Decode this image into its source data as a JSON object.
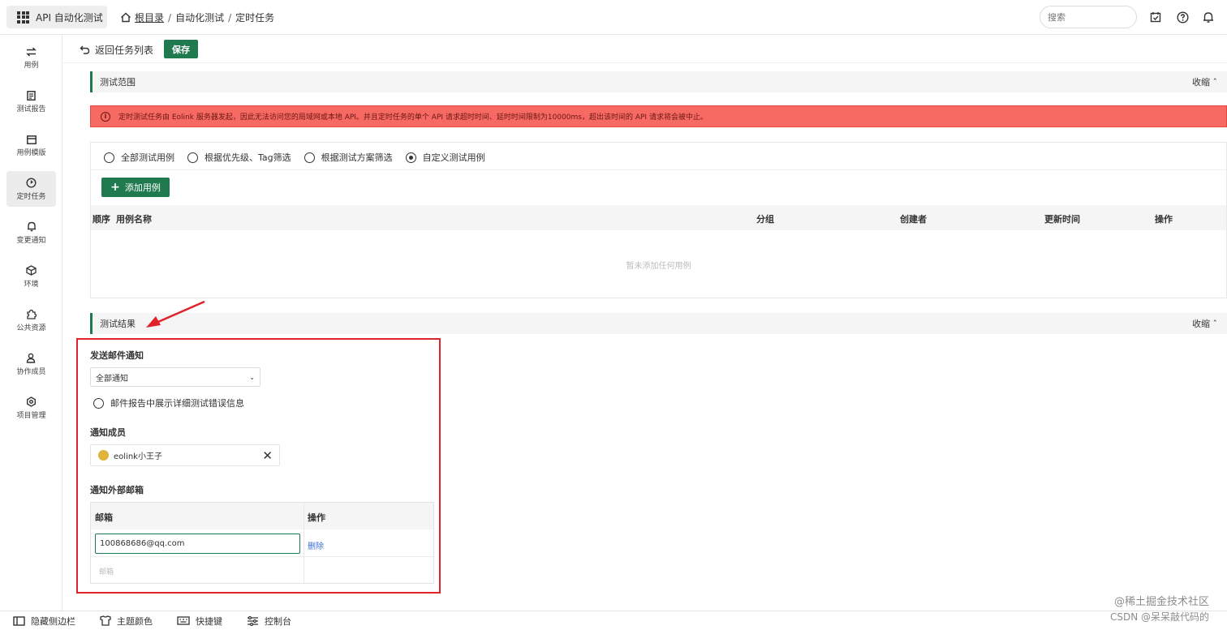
{
  "topbar": {
    "app_label": "API 自动化测试",
    "breadcrumb": {
      "root": "根目录",
      "items": [
        "自动化测试",
        "定时任务"
      ],
      "separator": "/"
    },
    "search_placeholder": "搜索"
  },
  "sidebar": {
    "items": [
      {
        "label": "用例",
        "icon": "swap-icon"
      },
      {
        "label": "测试报告",
        "icon": "report-icon"
      },
      {
        "label": "用例模版",
        "icon": "template-icon"
      },
      {
        "label": "定时任务",
        "icon": "clock-icon",
        "active": true
      },
      {
        "label": "变更通知",
        "icon": "bell-icon"
      },
      {
        "label": "环境",
        "icon": "cube-icon"
      },
      {
        "label": "公共资源",
        "icon": "puzzle-icon"
      },
      {
        "label": "协作成员",
        "icon": "users-icon"
      },
      {
        "label": "项目管理",
        "icon": "gear-icon"
      }
    ]
  },
  "toolbar": {
    "back_label": "返回任务列表",
    "save_label": "保存"
  },
  "scope_section": {
    "title": "测试范围",
    "collapse_label": "收缩",
    "alert": "定时测试任务由 Eolink 服务器发起，因此无法访问您的局域网或本地 API。并且定时任务的单个 API 请求超时时间、延时时间限制为10000ms，超出该时间的 API 请求将会被中止。",
    "radio_options": [
      "全部测试用例",
      "根据优先级、Tag筛选",
      "根据测试方案筛选",
      "自定义测试用例"
    ],
    "selected_option": 3,
    "add_button": "添加用例",
    "table_headers": {
      "order": "顺序",
      "name": "用例名称",
      "group": "分组",
      "creator": "创建者",
      "updated": "更新时间",
      "actions": "操作"
    },
    "empty_text": "暂未添加任何用例"
  },
  "result_section": {
    "title": "测试结果",
    "collapse_label": "收缩",
    "email_notify_label": "发送邮件通知",
    "email_notify_value": "全部通知",
    "detail_error_checkbox": "邮件报告中展示详细测试错误信息",
    "notify_members_label": "通知成员",
    "members": [
      "eolink小王子"
    ],
    "external_email_label": "通知外部邮箱",
    "email_table": {
      "headers": {
        "email": "邮箱",
        "actions": "操作"
      },
      "rows": [
        {
          "email": "100868686@qq.com",
          "action": "删除"
        }
      ],
      "new_placeholder": "邮箱"
    }
  },
  "bottombar": {
    "items": [
      {
        "label": "隐藏侧边栏",
        "icon": "sidebar-icon"
      },
      {
        "label": "主题颜色",
        "icon": "theme-icon"
      },
      {
        "label": "快捷键",
        "icon": "keyboard-icon"
      },
      {
        "label": "控制台",
        "icon": "console-icon"
      }
    ]
  },
  "watermark": {
    "line1": "@稀土掘金技术社区",
    "line2": "CSDN @呆呆敲代码的"
  },
  "colors": {
    "accent": "#1f7a4f",
    "alert_bg": "#f66a63",
    "highlight_border": "#e0232b",
    "link": "#3a6fd6"
  }
}
